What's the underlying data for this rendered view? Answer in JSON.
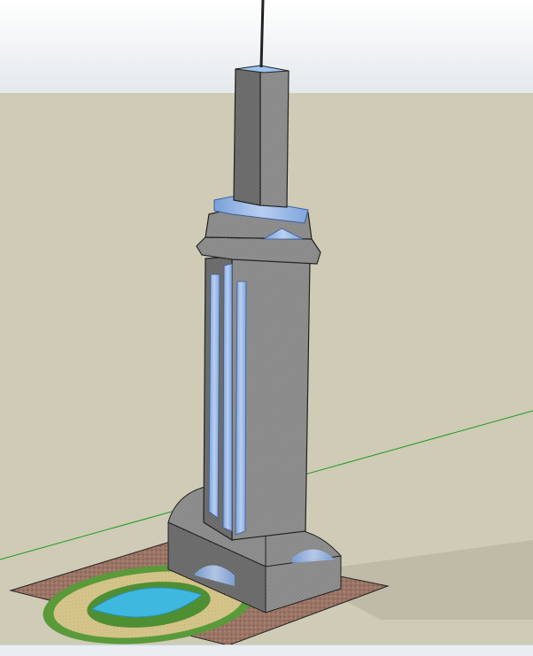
{
  "viewport": {
    "colors": {
      "sky_top": "#ffffff",
      "sky_bottom": "#e4e9ec",
      "ground": "#cfcbb6",
      "axis_green": "#1e9a1e",
      "building_gray": "#8f8f8f",
      "building_dark": "#6e6e6e",
      "glass_blue": "#8fb3e6",
      "pool_blue": "#3fb8e0",
      "lawn_green": "#5a9a3a",
      "sand": "#d4c48a",
      "gravel": "#9a7465",
      "status_strip": "#e8eef2"
    },
    "icons": [
      "antenna",
      "skyscraper",
      "podium",
      "fountain-pool",
      "landscape-plaza"
    ]
  }
}
